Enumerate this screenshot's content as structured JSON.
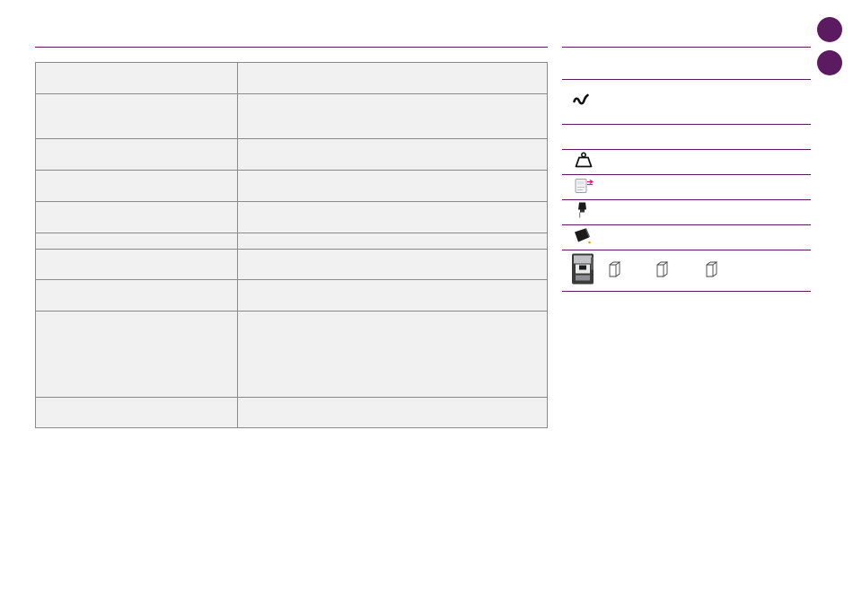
{
  "colors": {
    "accent": "#5c1a60",
    "table_fill": "#f1f1f1",
    "table_border": "#8a8a8a"
  },
  "icons": {
    "water_hardness": "wave-squiggle-icon",
    "weight": "weight-icon",
    "filter": "water-filter-icon",
    "milk_spout": "milk-spout-icon",
    "cleaning": "cleaning-tablet-icon",
    "machine": "coffee-machine-icon",
    "packages": [
      "package-icon",
      "package-icon",
      "package-icon"
    ]
  },
  "nav_dots": [
    "nav-dot-1",
    "nav-dot-2"
  ]
}
